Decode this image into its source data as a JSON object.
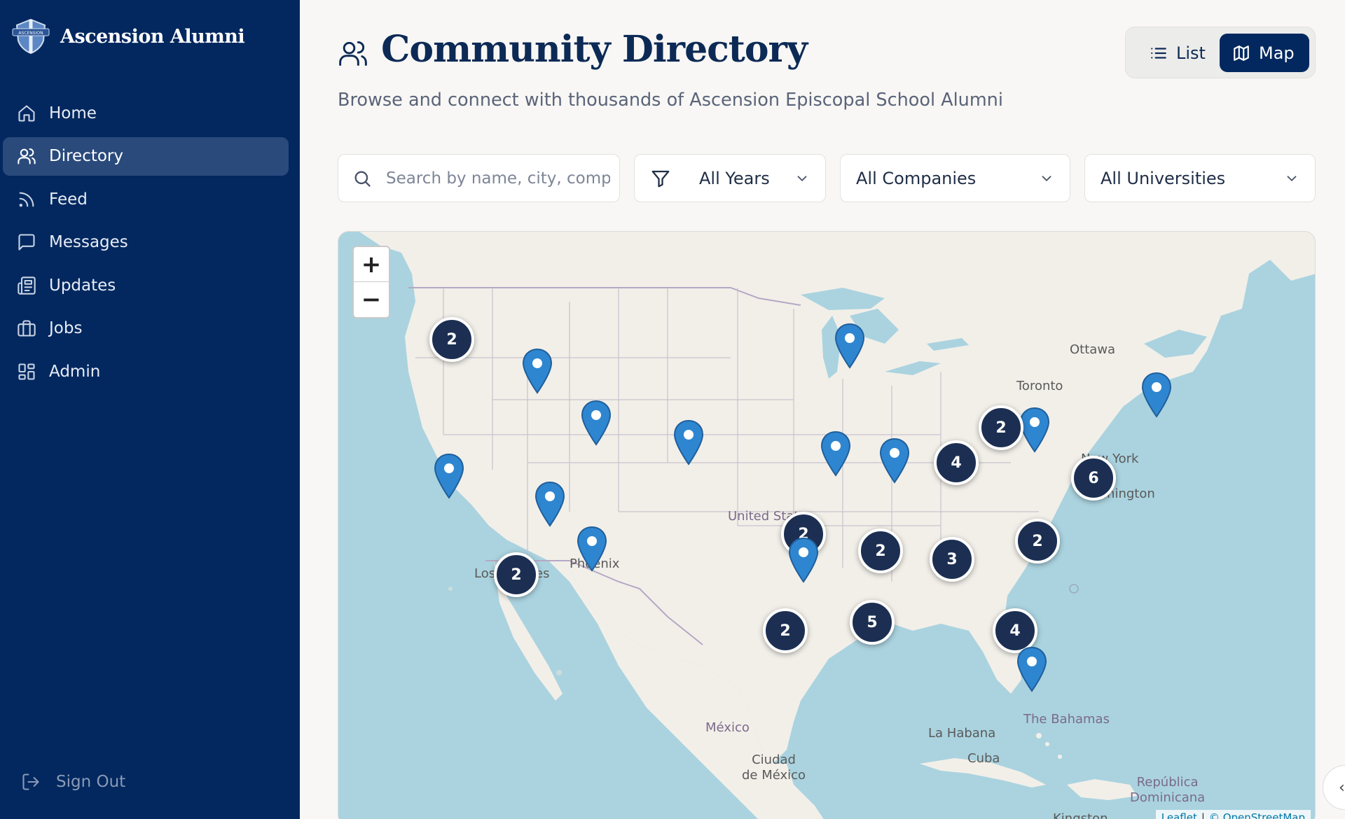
{
  "app": {
    "name": "Ascension Alumni",
    "logo_icon": "shield-crest-icon",
    "logo_text": "ASCENSION"
  },
  "sidebar": {
    "items": [
      {
        "label": "Home",
        "icon": "home-icon",
        "active": false
      },
      {
        "label": "Directory",
        "icon": "users-icon",
        "active": true
      },
      {
        "label": "Feed",
        "icon": "rss-icon",
        "active": false
      },
      {
        "label": "Messages",
        "icon": "message-square-icon",
        "active": false
      },
      {
        "label": "Updates",
        "icon": "newspaper-icon",
        "active": false
      },
      {
        "label": "Jobs",
        "icon": "briefcase-icon",
        "active": false
      },
      {
        "label": "Admin",
        "icon": "dashboard-icon",
        "active": false
      }
    ],
    "sign_out": "Sign Out"
  },
  "header": {
    "title": "Community Directory",
    "subtitle": "Browse and connect with thousands of Ascension Episcopal School Alumni",
    "view_toggle": {
      "list_label": "List",
      "map_label": "Map",
      "selected": "Map"
    }
  },
  "filters": {
    "search_placeholder": "Search by name, city, company...",
    "years": "All Years",
    "companies": "All Companies",
    "universities": "All Universities"
  },
  "map": {
    "zoom_in": "+",
    "zoom_out": "−",
    "labels": {
      "ottawa": "Ottawa",
      "toronto": "Toronto",
      "new_york": "New York",
      "washington": "Washington",
      "united_states": "United States",
      "phoenix": "Phoenix",
      "los_angeles": "Los Angeles",
      "mexico": "México",
      "ciudad_de_mexico": "Ciudad\nde México",
      "la_habana": "La Habana",
      "cuba": "Cuba",
      "the_bahamas": "The Bahamas",
      "republica_dominicana": "República\nDominicana",
      "kingston": "Kingston"
    },
    "clusters": [
      {
        "id": "seattle",
        "count": 2
      },
      {
        "id": "los-angeles",
        "count": 2
      },
      {
        "id": "oklahoma",
        "count": 2
      },
      {
        "id": "cleveland",
        "count": 2
      },
      {
        "id": "indiana",
        "count": 4
      },
      {
        "id": "new-york",
        "count": 6
      },
      {
        "id": "arkansas",
        "count": 2
      },
      {
        "id": "mississippi",
        "count": 3
      },
      {
        "id": "carolina",
        "count": 2
      },
      {
        "id": "texas",
        "count": 2
      },
      {
        "id": "louisiana",
        "count": 5
      },
      {
        "id": "florida",
        "count": 4
      }
    ],
    "attribution": {
      "leaflet": "Leaflet",
      "separator": "|",
      "osm": "© OpenStreetMap"
    }
  }
}
